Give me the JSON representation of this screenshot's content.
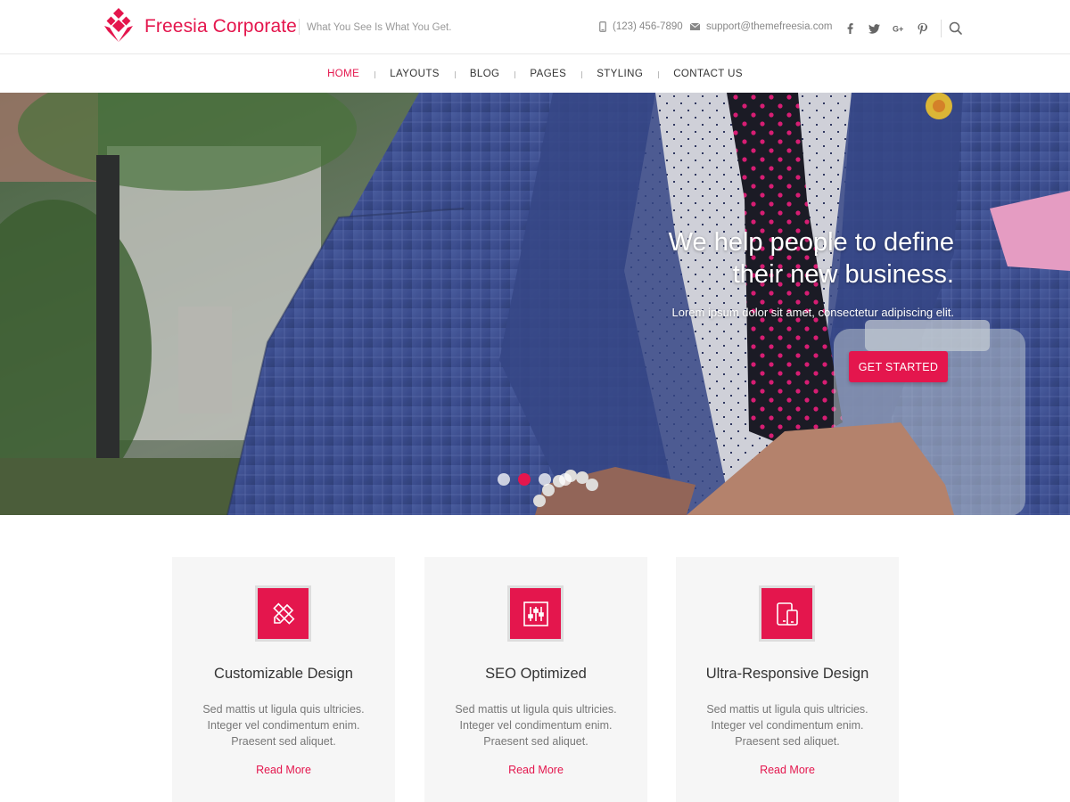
{
  "header": {
    "site_title": "Freesia Corporate",
    "tagline": "What You See Is What You Get.",
    "phone": "(123) 456-7890",
    "email": "support@themefreesia.com",
    "socials": [
      "facebook-icon",
      "twitter-icon",
      "google-plus-icon",
      "pinterest-icon"
    ],
    "accent_color": "#e4164d"
  },
  "nav": {
    "items": [
      "HOME",
      "LAYOUTS",
      "BLOG",
      "PAGES",
      "STYLING",
      "CONTACT US"
    ],
    "active": "HOME"
  },
  "hero": {
    "heading_line1": "We help people to define",
    "heading_line2": "their new business.",
    "subtitle": "Lorem ipsum dolor sit amet, consectetur adipiscing elit.",
    "button_label": "GET STARTED",
    "slide_count": 4,
    "active_slide": 2
  },
  "features": [
    {
      "icon": "pencil-ruler-icon",
      "title": "Customizable Design",
      "line1": "Sed mattis ut ligula quis ultricies.",
      "line2": "Integer vel condimentum enim.",
      "line3": "Praesent sed aliquet.",
      "link": "Read More"
    },
    {
      "icon": "sliders-icon",
      "title": "SEO Optimized",
      "line1": "Sed mattis ut ligula quis ultricies.",
      "line2": "Integer vel condimentum enim.",
      "line3": "Praesent sed aliquet.",
      "link": "Read More"
    },
    {
      "icon": "devices-icon",
      "title": "Ultra-Responsive Design",
      "line1": "Sed mattis ut ligula quis ultricies.",
      "line2": "Integer vel condimentum enim.",
      "line3": "Praesent sed aliquet.",
      "link": "Read More"
    }
  ]
}
